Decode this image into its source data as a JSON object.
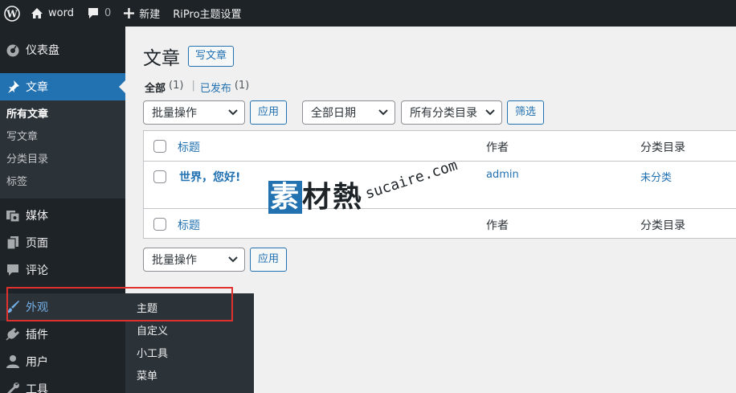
{
  "adminbar": {
    "site_name": "word",
    "comment_count": "0",
    "new_label": "新建",
    "theme_settings": "RiPro主题设置"
  },
  "sidebar": {
    "dashboard": "仪表盘",
    "posts": "文章",
    "posts_submenu": [
      "所有文章",
      "写文章",
      "分类目录",
      "标签"
    ],
    "media": "媒体",
    "pages": "页面",
    "comments": "评论",
    "appearance": "外观",
    "plugins": "插件",
    "users": "用户",
    "tools": "工具"
  },
  "flyout": {
    "items": [
      "主题",
      "自定义",
      "小工具",
      "菜单"
    ]
  },
  "page": {
    "title": "文章",
    "add_new": "写文章",
    "filters": {
      "all_label": "全部",
      "all_count": "(1)",
      "published_label": "已发布",
      "published_count": "(1)",
      "separator": "|"
    },
    "bulk_action": "批量操作",
    "apply": "应用",
    "all_dates": "全部日期",
    "all_categories": "所有分类目录",
    "filter": "筛选"
  },
  "table": {
    "columns": [
      "标题",
      "作者",
      "分类目录"
    ],
    "rows": [
      {
        "title": "世界，您好!",
        "author": "admin",
        "category": "未分类"
      }
    ]
  },
  "watermark": {
    "main_highlight": "素",
    "main_rest": "材熱",
    "sub": "sucaire.com"
  },
  "colors": {
    "admin_dark": "#1d2327",
    "accent": "#2271b1",
    "highlight_box": "#e0312f"
  }
}
